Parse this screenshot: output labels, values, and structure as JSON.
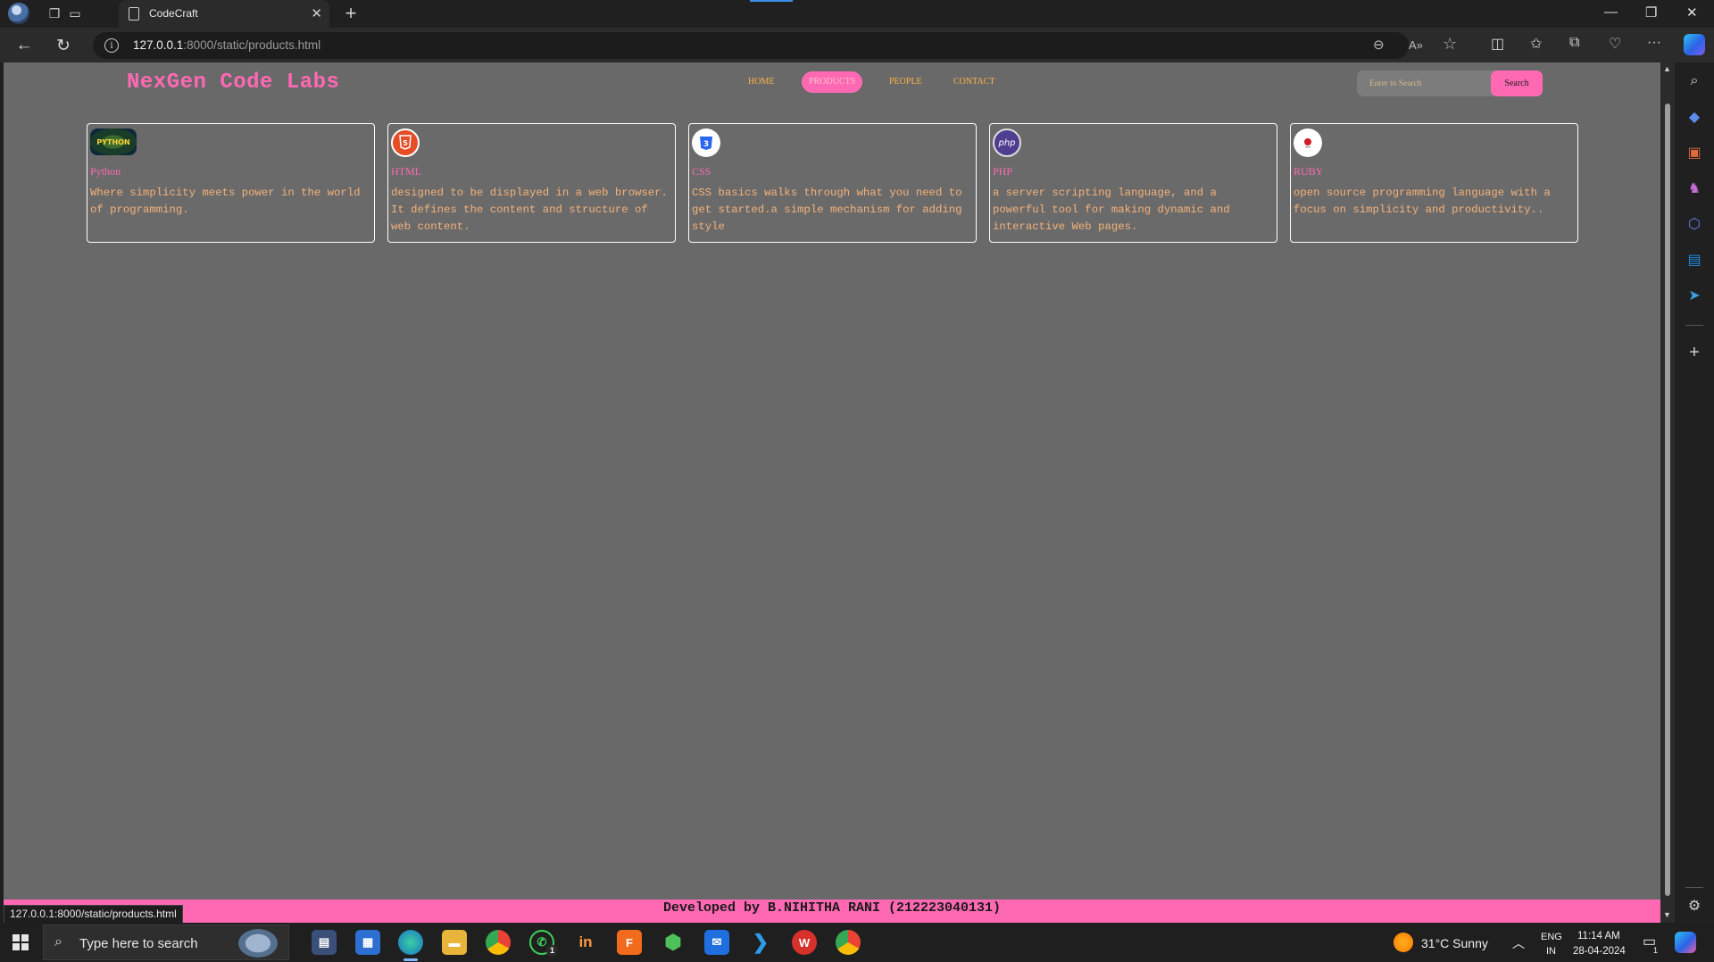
{
  "browser": {
    "tab_title": "CodeCraft",
    "tab_close": "✕",
    "new_tab": "+",
    "url_host": "127.0.0.1",
    "url_rest": ":8000/static/products.html",
    "status_url": "127.0.0.1:8000/static/products.html",
    "window": {
      "minimize": "—",
      "restore": "❐",
      "close": "✕"
    },
    "nav": {
      "back": "←",
      "refresh": "↻"
    },
    "toolbar": {
      "zoom": "⊖",
      "read_aloud": "A»",
      "favorite": "☆",
      "split": "◫",
      "favorites": "✩",
      "collections": "⧉",
      "health": "♡",
      "more": "···"
    }
  },
  "site": {
    "brand": "NexGen Code Labs",
    "nav": [
      {
        "label": "HOME",
        "active": false
      },
      {
        "label": "PRODUCTS",
        "active": true
      },
      {
        "label": "PEOPLE",
        "active": false
      },
      {
        "label": "CONTACT",
        "active": false
      }
    ],
    "search": {
      "placeholder": "Enter to Search",
      "button": "Search"
    },
    "products": [
      {
        "name": "Python",
        "icon": "python-logo",
        "desc": "Where simplicity meets power in the world of programming."
      },
      {
        "name": "HTML",
        "icon": "html5-logo",
        "desc": "designed to be displayed in a web browser. It defines the content and structure of web content."
      },
      {
        "name": "CSS",
        "icon": "css3-logo",
        "desc": "CSS basics walks through what you need to get started.a simple mechanism for adding style"
      },
      {
        "name": "PHP",
        "icon": "php-logo",
        "desc": "a server scripting language, and a powerful tool for making dynamic and interactive Web pages."
      },
      {
        "name": "RUBY",
        "icon": "ruby-logo",
        "desc": "open source programming language with a focus on simplicity and productivity.."
      }
    ],
    "footer": "Developed by B.NIHITHA RANI (212223040131)"
  },
  "taskbar": {
    "search_placeholder": "Type here to search",
    "whatsapp_badge": "1",
    "weather": "31°C  Sunny",
    "lang_line1": "ENG",
    "lang_line2": "IN",
    "time": "11:14 AM",
    "date": "28-04-2024",
    "notification_badge": "1"
  },
  "colors": {
    "accent_pink": "#ff69b4",
    "nav_orange": "#ffb347",
    "desc_orange": "#f5b27a",
    "page_bg": "#696969"
  }
}
